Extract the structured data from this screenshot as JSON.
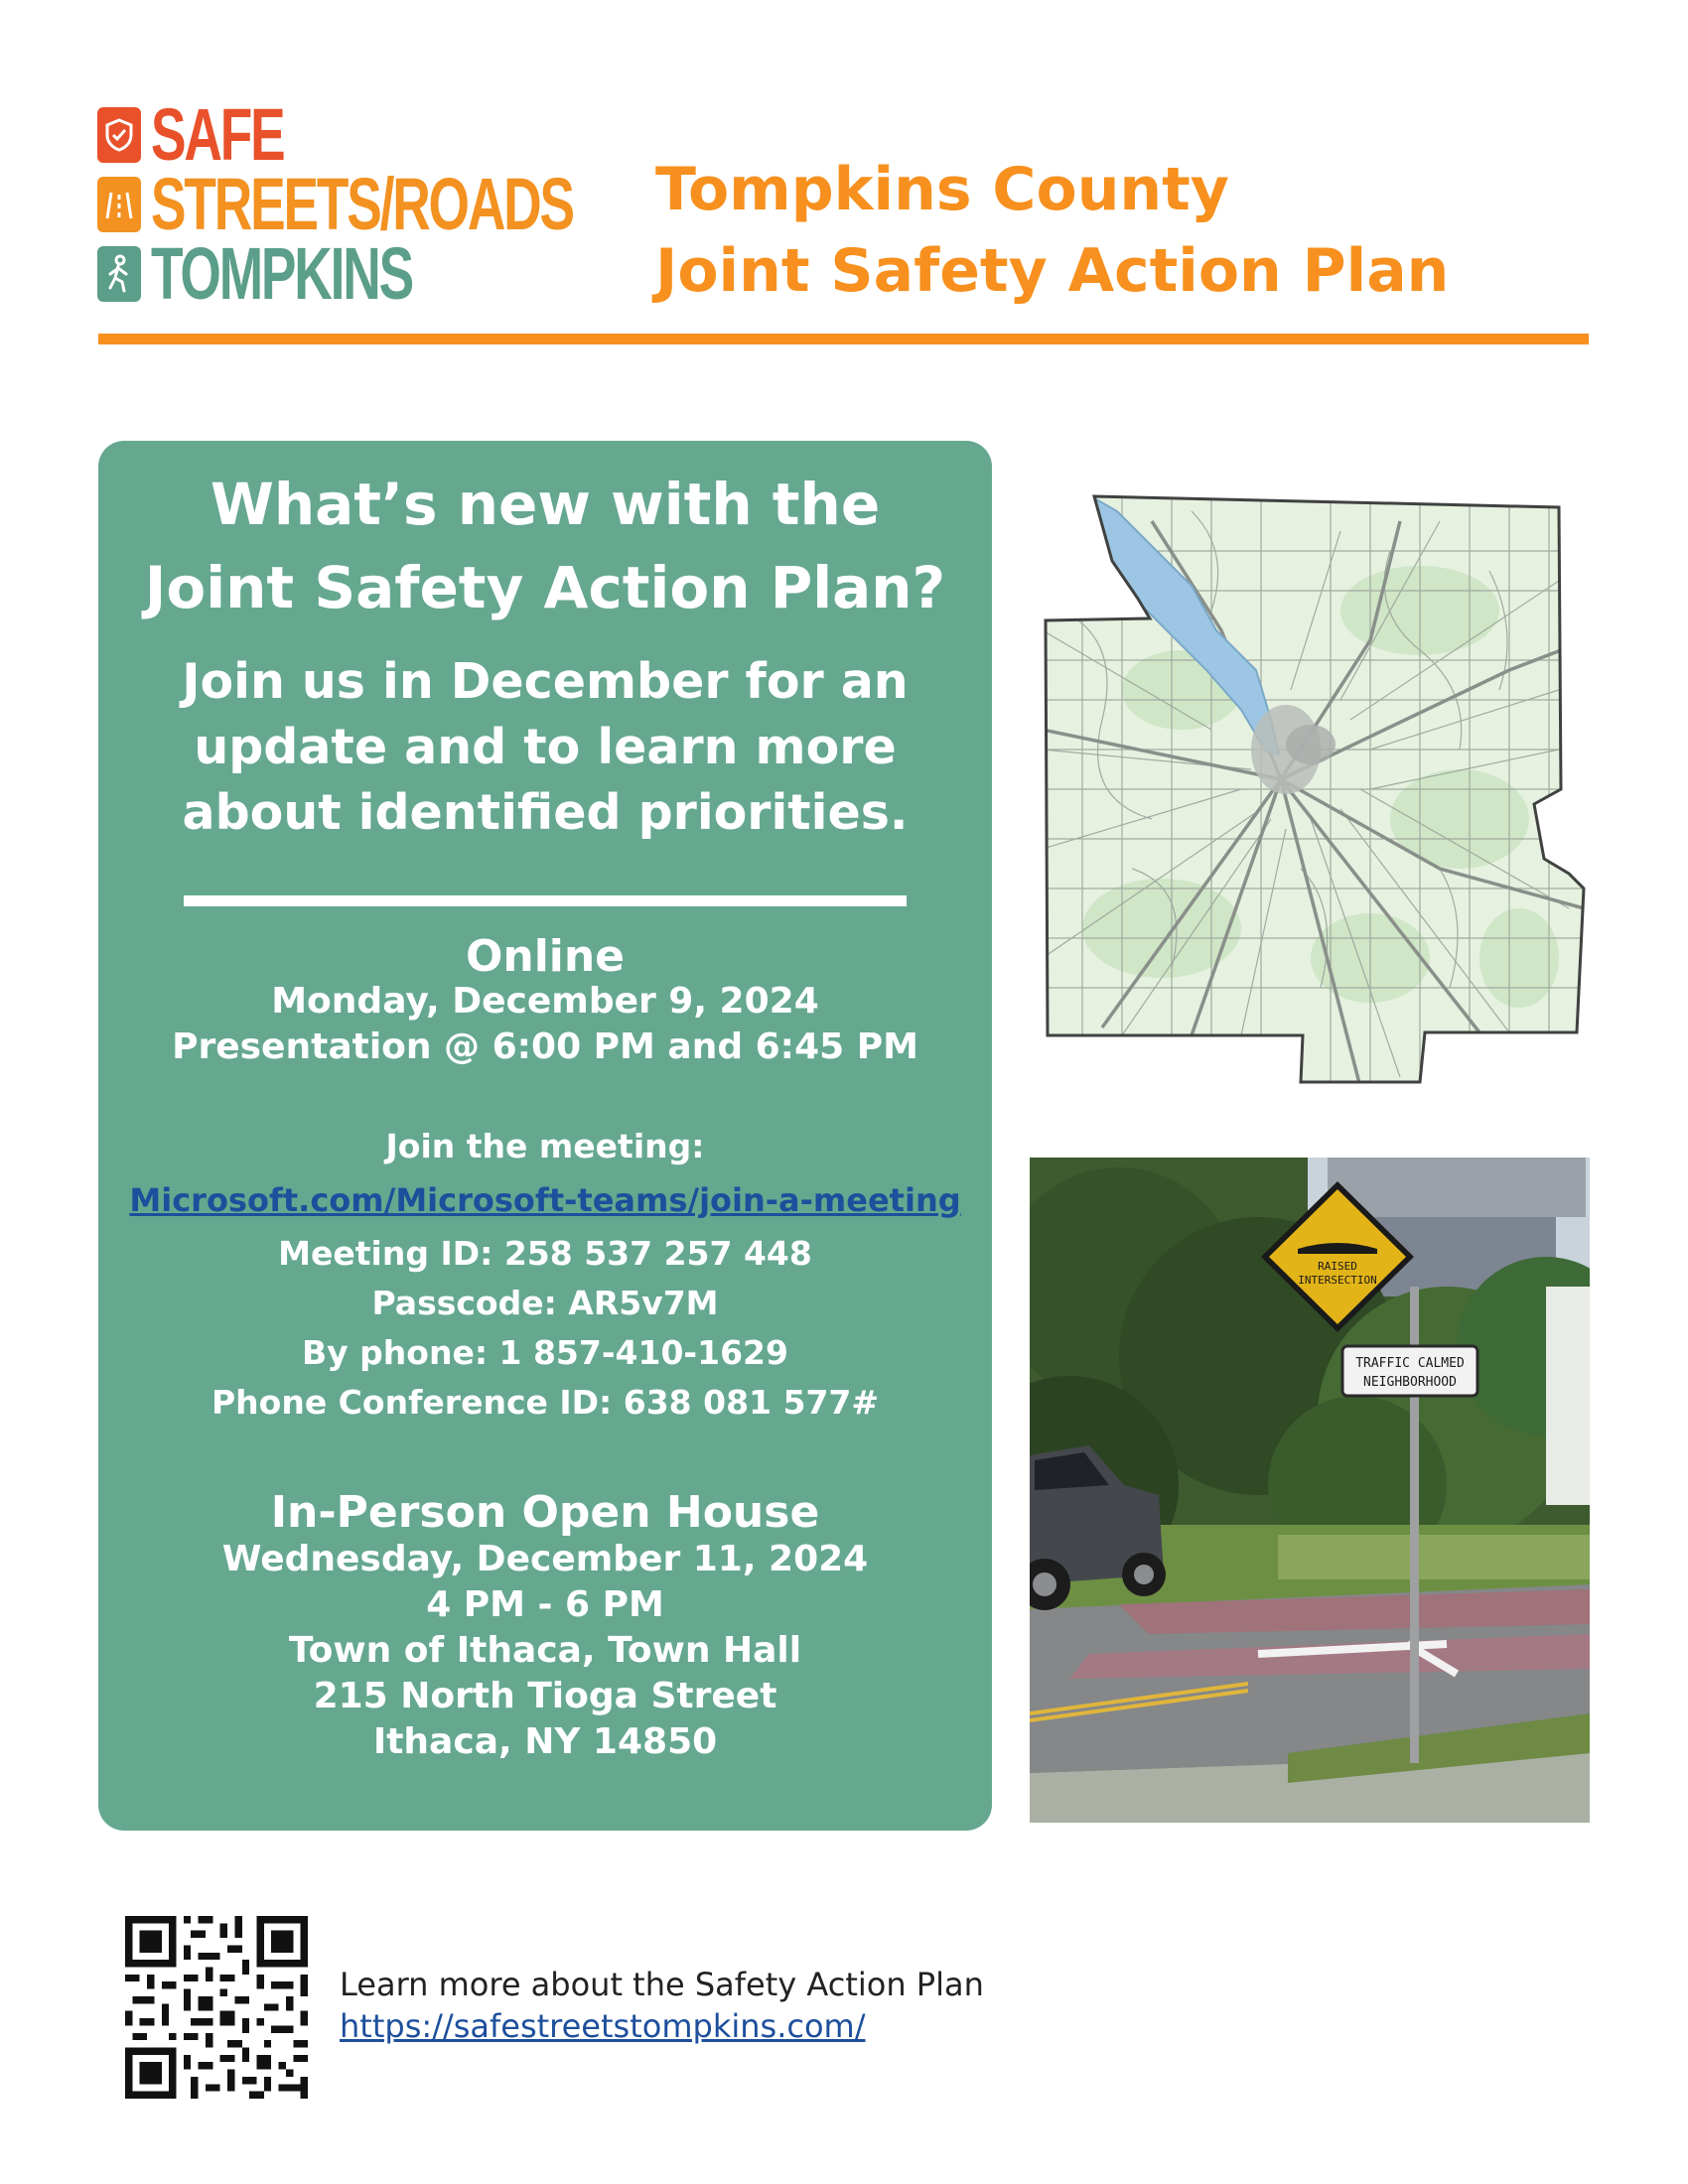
{
  "logo": {
    "line1": "SAFE",
    "line2": "STREETS/ROADS",
    "line3": "TOMPKINS"
  },
  "header": {
    "title_line1": "Tompkins County",
    "title_line2": "Joint Safety Action Plan"
  },
  "card": {
    "title_line1": "What’s new with the",
    "title_line2": "Joint Safety Action Plan?",
    "subtitle_line1": "Join us in December for an",
    "subtitle_line2": "update and to learn more",
    "subtitle_line3": "about identified priorities.",
    "online": {
      "heading": "Online",
      "date": "Monday, December 9, 2024",
      "time": "Presentation @ 6:00 PM and 6:45 PM",
      "join_label": "Join the meeting:",
      "link": "Microsoft.com/Microsoft-teams/join-a-meeting",
      "meeting_id": "Meeting ID: 258 537 257 448",
      "passcode": "Passcode: AR5v7M",
      "phone": "By phone: 1 857-410-1629",
      "conference_id": "Phone Conference ID: 638 081 577#"
    },
    "in_person": {
      "heading": "In-Person Open House",
      "date": "Wednesday, December 11, 2024",
      "time": "4 PM - 6 PM",
      "venue": "Town of Ithaca, Town Hall",
      "street": "215 North Tioga Street",
      "city": "Ithaca, NY 14850"
    }
  },
  "photo": {
    "sign_top_line1": "RAISED",
    "sign_top_line2": "INTERSECTION",
    "sign_bottom_line1": "TRAFFIC CALMED",
    "sign_bottom_line2": "NEIGHBORHOOD"
  },
  "footer": {
    "text": "Learn more about the Safety Action Plan",
    "url": "https://safestreetstompkins.com/"
  },
  "colors": {
    "orange": "#f7901e",
    "red": "#e8512a",
    "green": "#65a88f",
    "link": "#1d4f9c"
  }
}
